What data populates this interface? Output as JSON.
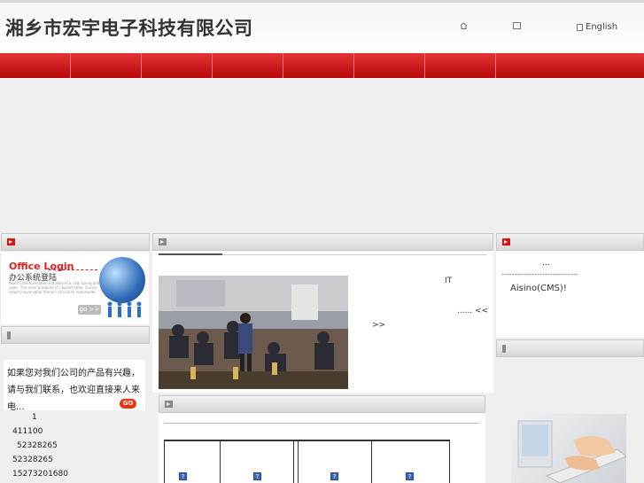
{
  "header": {
    "company_name": "湘乡市宏宇电子科技有限公司",
    "links": [
      {
        "label": "",
        "icon": "home-icon"
      },
      {
        "label": "",
        "icon": "bookmark-icon"
      },
      {
        "label": "English",
        "icon": "language-icon"
      }
    ]
  },
  "nav": {
    "items": [
      "",
      "",
      "",
      "",
      "",
      "",
      "",
      ""
    ],
    "color": "#c81010"
  },
  "left": {
    "login_panel_title": "",
    "login_en": "Office Login",
    "login_cn": "办公系统登陆",
    "login_small": "Aoxin Communication Industrial Co. Ltd. toring and sales. The main products of c Board radio. Xunxin select conveniable Aronxin of civilian nationwide.",
    "login_go": "go >>",
    "contact_panel_title": "",
    "contact_text": "如果您对我们公司的产品有兴趣，请与我们联系，也欢迎直接来人来电...",
    "contact_go": "GO",
    "contact_list": [
      "1",
      "411100",
      "52328265",
      "52328265",
      "15273201680"
    ]
  },
  "center": {
    "news_title": "",
    "news_text_1": "IT",
    "news_more": "...... <<",
    "news_more2": ">>",
    "products_title": "",
    "product_icons": [
      "?",
      "?",
      "?",
      "?"
    ]
  },
  "right": {
    "panel1_title": "",
    "dots": "...",
    "dashes": "------------------------------",
    "cms": "Aisino(CMS)!",
    "panel2_title": ""
  }
}
